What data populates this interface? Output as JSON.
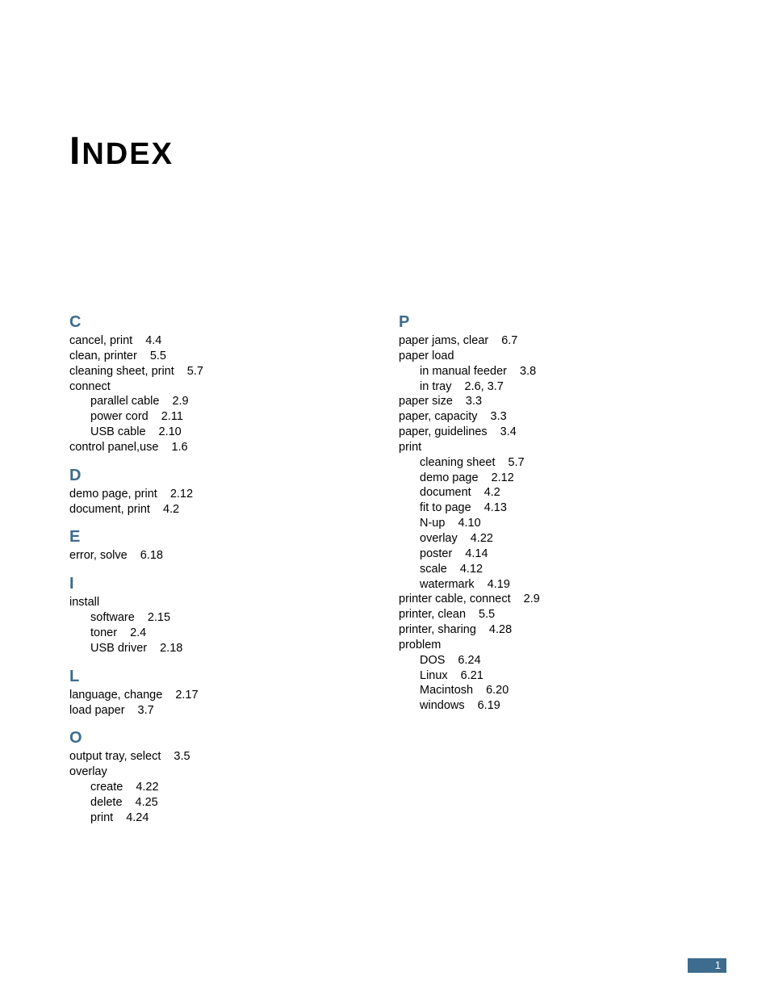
{
  "title_first": "I",
  "title_rest": "NDEX",
  "page_number": "1",
  "left_sections": [
    {
      "letter": "C",
      "entries": [
        {
          "level": 0,
          "term": "cancel, print",
          "ref": "4.4"
        },
        {
          "level": 0,
          "term": "clean, printer",
          "ref": "5.5"
        },
        {
          "level": 0,
          "term": "cleaning sheet, print",
          "ref": "5.7"
        },
        {
          "level": 0,
          "term": "connect",
          "ref": ""
        },
        {
          "level": 1,
          "term": "parallel cable",
          "ref": "2.9"
        },
        {
          "level": 1,
          "term": "power cord",
          "ref": "2.11"
        },
        {
          "level": 1,
          "term": "USB cable",
          "ref": "2.10"
        },
        {
          "level": 0,
          "term": "control panel,use",
          "ref": "1.6"
        }
      ]
    },
    {
      "letter": "D",
      "entries": [
        {
          "level": 0,
          "term": "demo page, print",
          "ref": "2.12"
        },
        {
          "level": 0,
          "term": "document, print",
          "ref": "4.2"
        }
      ]
    },
    {
      "letter": "E",
      "entries": [
        {
          "level": 0,
          "term": "error, solve",
          "ref": "6.18"
        }
      ]
    },
    {
      "letter": "I",
      "entries": [
        {
          "level": 0,
          "term": "install",
          "ref": ""
        },
        {
          "level": 1,
          "term": "software",
          "ref": "2.15"
        },
        {
          "level": 1,
          "term": "toner",
          "ref": "2.4"
        },
        {
          "level": 1,
          "term": "USB driver",
          "ref": "2.18"
        }
      ]
    },
    {
      "letter": "L",
      "entries": [
        {
          "level": 0,
          "term": "language, change",
          "ref": "2.17"
        },
        {
          "level": 0,
          "term": "load paper",
          "ref": "3.7"
        }
      ]
    },
    {
      "letter": "O",
      "entries": [
        {
          "level": 0,
          "term": "output tray, select",
          "ref": "3.5"
        },
        {
          "level": 0,
          "term": "overlay",
          "ref": ""
        },
        {
          "level": 1,
          "term": "create",
          "ref": "4.22"
        },
        {
          "level": 1,
          "term": "delete",
          "ref": "4.25"
        },
        {
          "level": 1,
          "term": "print",
          "ref": "4.24"
        }
      ]
    }
  ],
  "right_sections": [
    {
      "letter": "P",
      "entries": [
        {
          "level": 0,
          "term": "paper jams, clear",
          "ref": "6.7"
        },
        {
          "level": 0,
          "term": "paper load",
          "ref": ""
        },
        {
          "level": 1,
          "term": "in manual feeder",
          "ref": "3.8"
        },
        {
          "level": 1,
          "term": "in tray",
          "ref": "2.6,  3.7"
        },
        {
          "level": 0,
          "term": "paper size",
          "ref": "3.3"
        },
        {
          "level": 0,
          "term": "paper, capacity",
          "ref": "3.3"
        },
        {
          "level": 0,
          "term": "paper, guidelines",
          "ref": "3.4"
        },
        {
          "level": 0,
          "term": "print",
          "ref": ""
        },
        {
          "level": 1,
          "term": "cleaning sheet",
          "ref": "5.7"
        },
        {
          "level": 1,
          "term": "demo page",
          "ref": "2.12"
        },
        {
          "level": 1,
          "term": "document",
          "ref": "4.2"
        },
        {
          "level": 1,
          "term": "fit to page",
          "ref": "4.13"
        },
        {
          "level": 1,
          "term": "N-up",
          "ref": "4.10"
        },
        {
          "level": 1,
          "term": "overlay",
          "ref": "4.22"
        },
        {
          "level": 1,
          "term": "poster",
          "ref": "4.14"
        },
        {
          "level": 1,
          "term": "scale",
          "ref": "4.12"
        },
        {
          "level": 1,
          "term": "watermark",
          "ref": "4.19"
        },
        {
          "level": 0,
          "term": "printer cable, connect",
          "ref": "2.9"
        },
        {
          "level": 0,
          "term": "printer, clean",
          "ref": "5.5"
        },
        {
          "level": 0,
          "term": "printer, sharing",
          "ref": "4.28"
        },
        {
          "level": 0,
          "term": "problem",
          "ref": ""
        },
        {
          "level": 1,
          "term": "DOS",
          "ref": "6.24"
        },
        {
          "level": 1,
          "term": "Linux",
          "ref": "6.21"
        },
        {
          "level": 1,
          "term": "Macintosh",
          "ref": "6.20"
        },
        {
          "level": 1,
          "term": "windows",
          "ref": "6.19"
        }
      ]
    }
  ]
}
